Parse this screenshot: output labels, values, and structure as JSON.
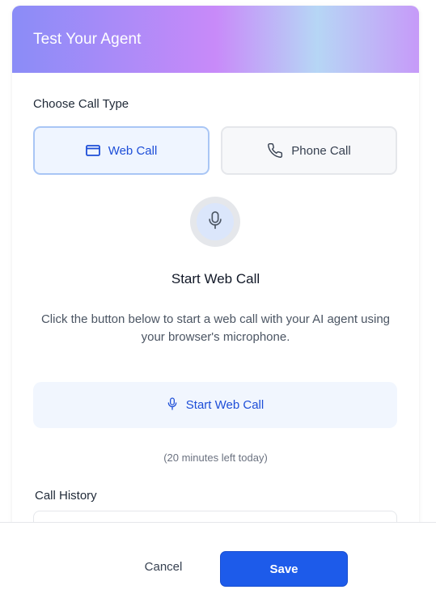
{
  "dialog": {
    "title": "Test Your Agent"
  },
  "call_type": {
    "label": "Choose Call Type",
    "options": [
      {
        "label": "Web Call",
        "icon": "browser-window-icon",
        "selected": true
      },
      {
        "label": "Phone Call",
        "icon": "phone-icon",
        "selected": false
      }
    ]
  },
  "web_call": {
    "icon": "microphone-icon",
    "heading": "Start Web Call",
    "description": "Click the button below to start a web call with your AI agent using your browser's microphone.",
    "button_label": "Start Web Call",
    "minutes_left": "(20 minutes left today)"
  },
  "history": {
    "label": "Call History"
  },
  "footer": {
    "cancel_label": "Cancel",
    "save_label": "Save"
  },
  "colors": {
    "accent": "#1d5bea",
    "selected_bg": "#eff5ff",
    "selected_border": "#a9c6f5"
  }
}
